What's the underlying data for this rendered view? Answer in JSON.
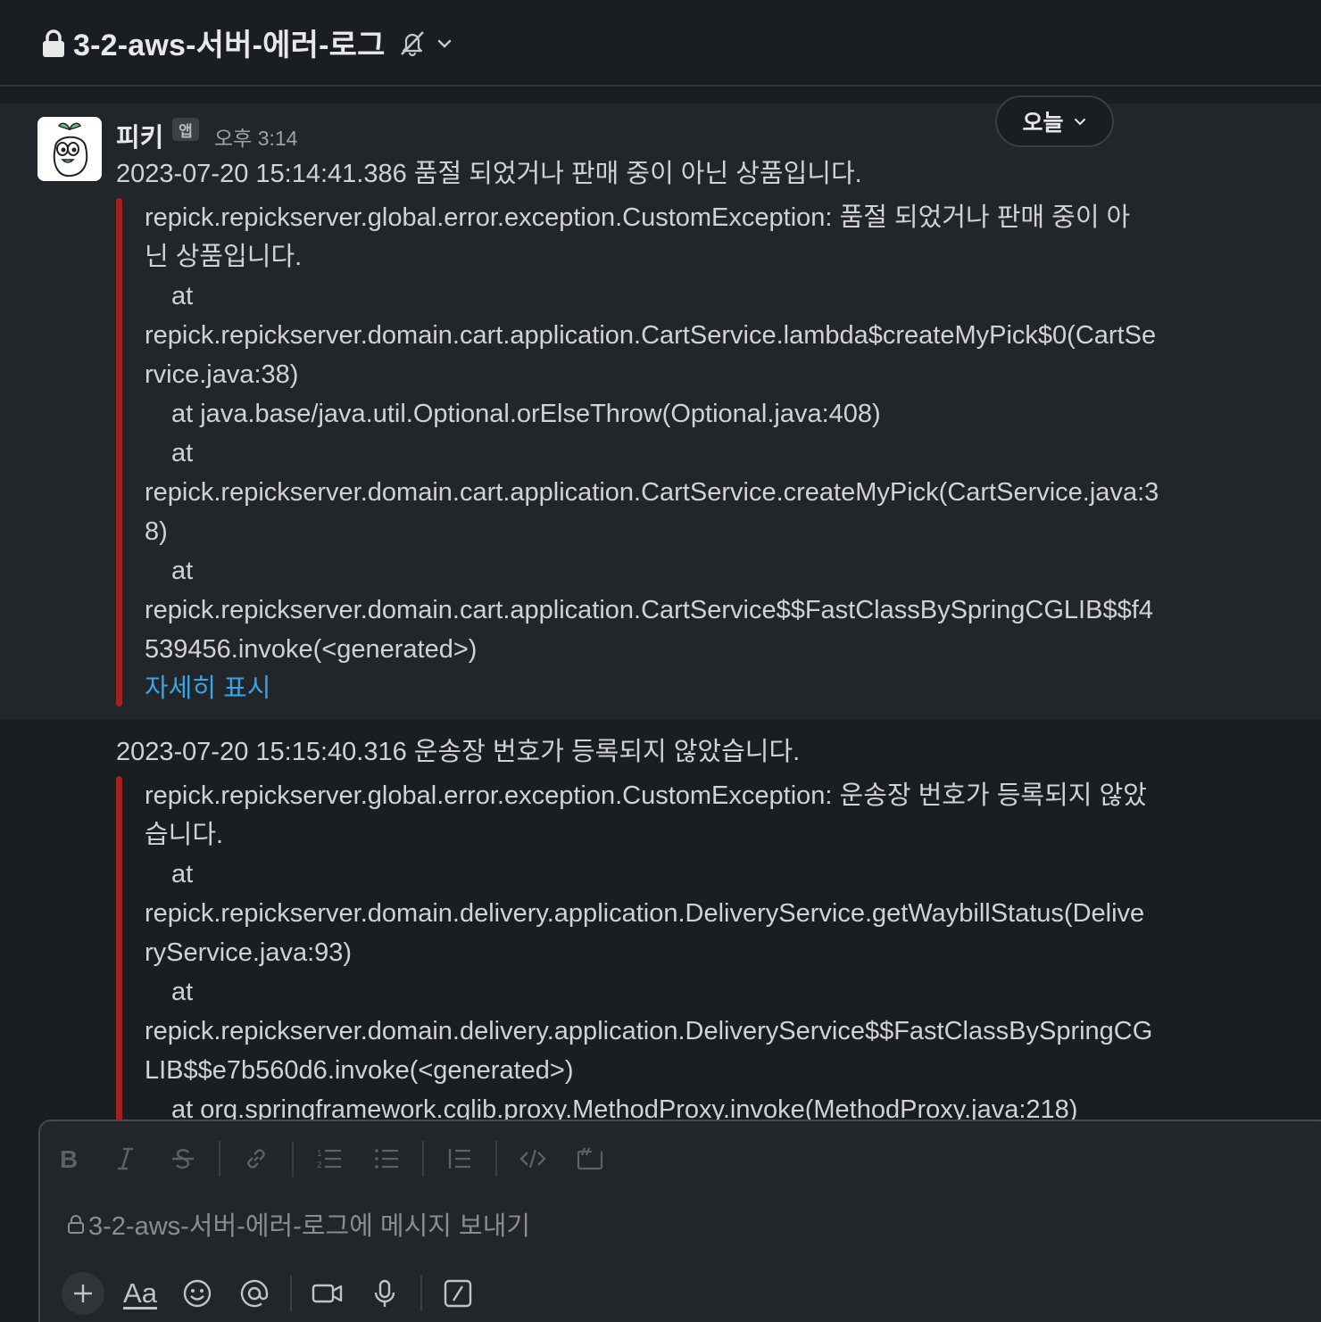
{
  "header": {
    "channel_name": "3-2-aws-서버-에러-로그"
  },
  "date_divider": {
    "label": "오늘"
  },
  "messages": [
    {
      "author": "피키",
      "badge": "앱",
      "time": "오후 3:14",
      "text": "2023-07-20 15:14:41.386 품절 되었거나 판매 중이 아닌 상품입니다.",
      "attachment_lines": [
        "repick.repickserver.global.error.exception.CustomException: 품절 되었거나 판매 중이 아",
        "닌 상품입니다.",
        "at",
        "repick.repickserver.domain.cart.application.CartService.lambda$createMyPick$0(CartSe",
        "rvice.java:38)",
        "at java.base/java.util.Optional.orElseThrow(Optional.java:408)",
        "at",
        "repick.repickserver.domain.cart.application.CartService.createMyPick(CartService.java:3",
        "8)",
        "at",
        "repick.repickserver.domain.cart.application.CartService$$FastClassBySpringCGLIB$$f4",
        "539456.invoke(<generated>)"
      ],
      "show_more": "자세히 표시"
    },
    {
      "text": "2023-07-20 15:15:40.316 운송장 번호가 등록되지 않았습니다.",
      "attachment_lines": [
        "repick.repickserver.global.error.exception.CustomException: 운송장 번호가 등록되지 않았",
        "습니다.",
        "at",
        "repick.repickserver.domain.delivery.application.DeliveryService.getWaybillStatus(Delive",
        "ryService.java:93)",
        "at",
        "repick.repickserver.domain.delivery.application.DeliveryService$$FastClassBySpringCG",
        "LIB$$e7b560d6.invoke(<generated>)",
        "at org.springframework.cglib.proxy.MethodProxy.invoke(MethodProxy.java:218)"
      ]
    }
  ],
  "composer": {
    "placeholder": "3-2-aws-서버-에러-로그에 메시지 보내기",
    "toolbar_icons": [
      "bold-icon",
      "italic-icon",
      "strikethrough-icon",
      "link-icon",
      "ordered-list-icon",
      "bulleted-list-icon",
      "blockquote-icon",
      "code-icon",
      "code-block-icon"
    ],
    "aa_label": "Aa"
  }
}
